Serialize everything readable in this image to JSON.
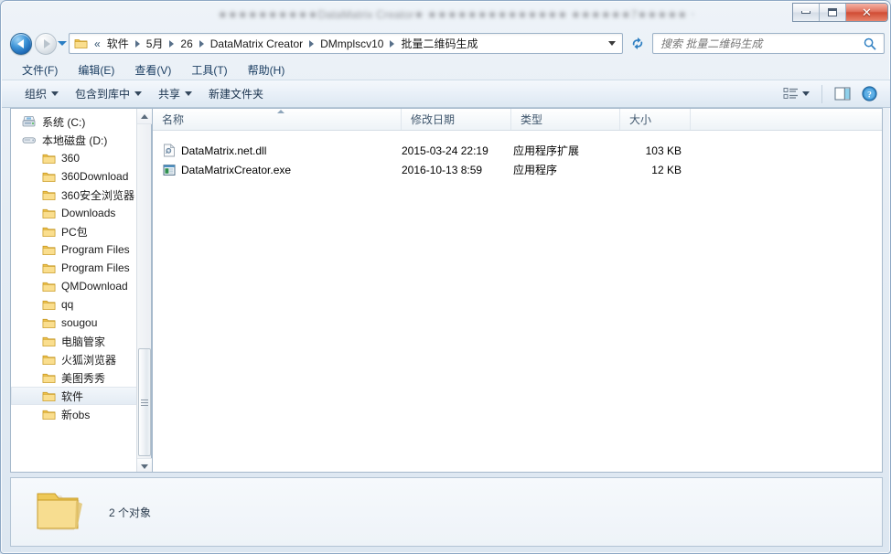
{
  "window": {
    "title_obscured": "★★★★★★★★★★DataMatrix Creator★ ★★★★★★★★★★★★★★ ★★★★★★7★★★★★  ★★★★★★★★★",
    "controls": {
      "minimize_label": "最小化",
      "maximize_label": "最大化",
      "close_label": "关闭",
      "close_glyph": "✕"
    }
  },
  "nav": {
    "back_label": "后退",
    "forward_label": "前进",
    "history_label": "最近浏览的位置",
    "double_chevron": "«",
    "breadcrumbs": [
      {
        "label": "软件"
      },
      {
        "label": "5月"
      },
      {
        "label": "26"
      },
      {
        "label": "DataMatrix Creator"
      },
      {
        "label": "DMmplscv10"
      },
      {
        "label": "批量二维码生成"
      }
    ],
    "dropdown_label": "以前的位置",
    "refresh_label": "刷新"
  },
  "search": {
    "placeholder": "搜索 批量二维码生成",
    "value": "",
    "icon": "search-icon"
  },
  "menubar": {
    "items": [
      {
        "label": "文件(F)"
      },
      {
        "label": "编辑(E)"
      },
      {
        "label": "查看(V)"
      },
      {
        "label": "工具(T)"
      },
      {
        "label": "帮助(H)"
      }
    ]
  },
  "toolbar": {
    "buttons": [
      {
        "label": "组织",
        "has_caret": true
      },
      {
        "label": "包含到库中",
        "has_caret": true
      },
      {
        "label": "共享",
        "has_caret": true
      },
      {
        "label": "新建文件夹",
        "has_caret": false
      }
    ],
    "view_button_label": "更改您的视图",
    "preview_button_label": "显示预览窗格",
    "help_button_label": "获取帮助"
  },
  "sidebar": {
    "items": [
      {
        "label": "系统 (C:)",
        "level": 1,
        "icon": "system-drive-icon",
        "selected": false
      },
      {
        "label": "本地磁盘 (D:)",
        "level": 1,
        "icon": "hard-drive-icon",
        "selected": false
      },
      {
        "label": "360",
        "level": 2,
        "icon": "folder-icon",
        "selected": false
      },
      {
        "label": "360Download",
        "level": 2,
        "icon": "folder-icon",
        "selected": false
      },
      {
        "label": "360安全浏览器",
        "level": 2,
        "icon": "folder-icon",
        "selected": false
      },
      {
        "label": "Downloads",
        "level": 2,
        "icon": "folder-icon",
        "selected": false
      },
      {
        "label": "PC包",
        "level": 2,
        "icon": "folder-icon",
        "selected": false
      },
      {
        "label": "Program Files",
        "level": 2,
        "icon": "folder-icon",
        "selected": false
      },
      {
        "label": "Program Files",
        "level": 2,
        "icon": "folder-icon",
        "selected": false
      },
      {
        "label": "QMDownload",
        "level": 2,
        "icon": "folder-icon",
        "selected": false
      },
      {
        "label": "qq",
        "level": 2,
        "icon": "folder-icon",
        "selected": false
      },
      {
        "label": "sougou",
        "level": 2,
        "icon": "folder-icon",
        "selected": false
      },
      {
        "label": "电脑管家",
        "level": 2,
        "icon": "folder-icon",
        "selected": false
      },
      {
        "label": "火狐浏览器",
        "level": 2,
        "icon": "folder-icon",
        "selected": false
      },
      {
        "label": "美图秀秀",
        "level": 2,
        "icon": "folder-icon",
        "selected": false
      },
      {
        "label": "软件",
        "level": 2,
        "icon": "folder-icon",
        "selected": true
      },
      {
        "label": "新obs",
        "level": 2,
        "icon": "folder-icon",
        "selected": false
      }
    ],
    "scrollbar": {
      "up_label": "向上滚动",
      "down_label": "向下滚动"
    }
  },
  "filelist": {
    "columns": [
      {
        "key": "name",
        "label": "名称",
        "sorted": "asc"
      },
      {
        "key": "date",
        "label": "修改日期",
        "sorted": ""
      },
      {
        "key": "type",
        "label": "类型",
        "sorted": ""
      },
      {
        "key": "size",
        "label": "大小",
        "sorted": ""
      }
    ],
    "rows": [
      {
        "name": "DataMatrix.net.dll",
        "date": "2015-03-24 22:19",
        "type": "应用程序扩展",
        "size": "103 KB",
        "icon": "dll-file-icon"
      },
      {
        "name": "DataMatrixCreator.exe",
        "date": "2016-10-13 8:59",
        "type": "应用程序",
        "size": "12 KB",
        "icon": "exe-file-icon"
      }
    ]
  },
  "details": {
    "icon": "large-folder-icon",
    "text": "2 个对象"
  },
  "colors": {
    "accent": "#2b7fc4",
    "frame": "#8ea8c4",
    "folder_yellow": "#f5cc62",
    "close_red": "#d04c34",
    "header_text": "#40576e"
  }
}
